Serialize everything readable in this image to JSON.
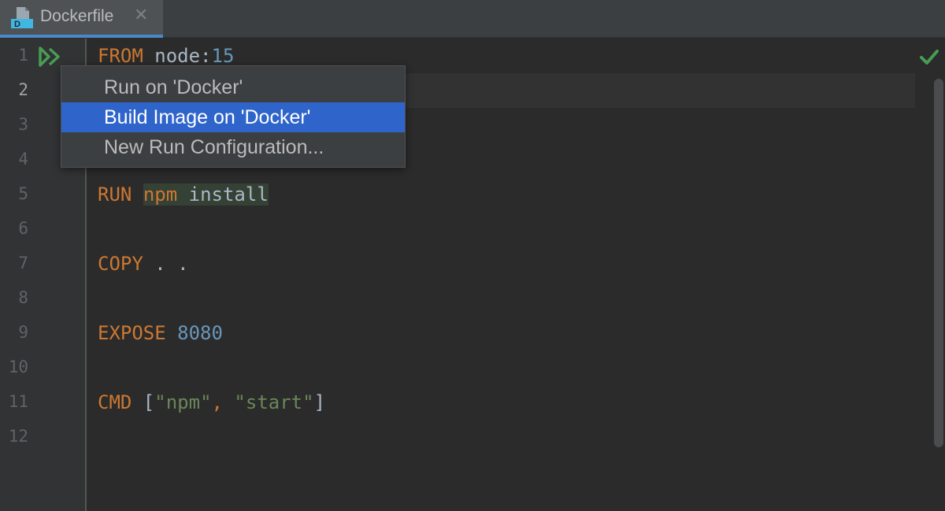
{
  "tab": {
    "file_name": "Dockerfile",
    "icon": "dockerfile-icon",
    "icon_letter": "D",
    "close_glyph": "✕"
  },
  "gutter": {
    "line_numbers": [
      "1",
      "2",
      "3",
      "4",
      "5",
      "6",
      "7",
      "8",
      "9",
      "10",
      "11",
      "12"
    ],
    "run_icon": "run-double-arrow-icon"
  },
  "code": {
    "line1": {
      "keyword": "FROM",
      "image": " node:",
      "tag": "15"
    },
    "line5": {
      "keyword": "RUN",
      "space": " ",
      "cmd": "npm",
      "args": " install"
    },
    "line7": {
      "keyword": "COPY",
      "args": " . ."
    },
    "line9": {
      "keyword": "EXPOSE",
      "space": " ",
      "port": "8080"
    },
    "line11": {
      "keyword": "CMD",
      "open": " [",
      "arg1": "\"npm\"",
      "sep": ", ",
      "arg2": "\"start\"",
      "close": "]"
    }
  },
  "popup_menu": {
    "items": [
      {
        "label": "Run on 'Docker'",
        "selected": false
      },
      {
        "label": "Build Image on 'Docker'",
        "selected": true
      },
      {
        "label": "New Run Configuration...",
        "selected": false
      }
    ]
  },
  "status": {
    "inspection_icon": "checkmark-icon"
  },
  "colors": {
    "editor_bg": "#2b2b2b",
    "keyword": "#cc7832",
    "number": "#6897bb",
    "string": "#6a8759",
    "selection": "#2f65ca",
    "run_icon": "#499c54",
    "tab_accent": "#4a88c7"
  }
}
